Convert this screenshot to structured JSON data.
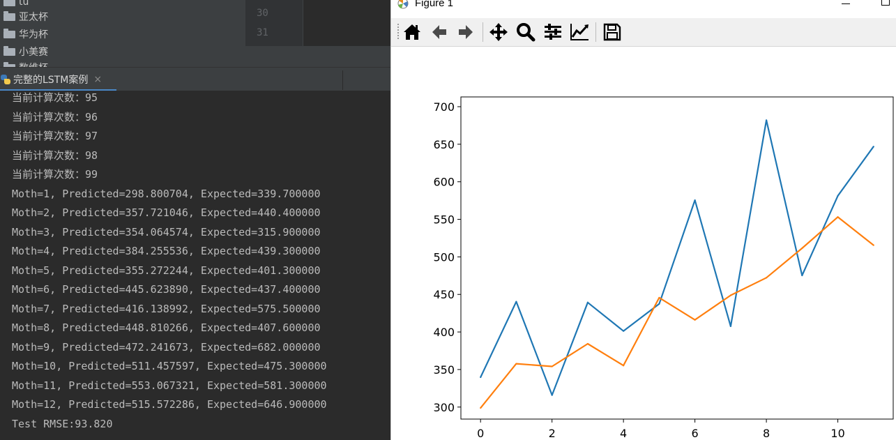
{
  "project": {
    "folders": [
      "tu",
      "亚太杯",
      "华为杯",
      "小美赛",
      "数维杯"
    ]
  },
  "gutter": {
    "lines": [
      "30",
      "31"
    ]
  },
  "run": {
    "tab_label": "完整的LSTM案例",
    "close": "×"
  },
  "console": {
    "lines": [
      "当前计算次数：95",
      "当前计算次数：96",
      "当前计算次数：97",
      "当前计算次数：98",
      "当前计算次数：99",
      "Moth=1, Predicted=298.800704, Expected=339.700000",
      "Moth=2, Predicted=357.721046, Expected=440.400000",
      "Moth=3, Predicted=354.064574, Expected=315.900000",
      "Moth=4, Predicted=384.255536, Expected=439.300000",
      "Moth=5, Predicted=355.272244, Expected=401.300000",
      "Moth=6, Predicted=445.623890, Expected=437.400000",
      "Moth=7, Predicted=416.138992, Expected=575.500000",
      "Moth=8, Predicted=448.810266, Expected=407.600000",
      "Moth=9, Predicted=472.241673, Expected=682.000000",
      "Moth=10, Predicted=511.457597, Expected=475.300000",
      "Moth=11, Predicted=553.067321, Expected=581.300000",
      "Moth=12, Predicted=515.572286, Expected=646.900000",
      "Test RMSE:93.820"
    ]
  },
  "figure": {
    "title": "Figure 1",
    "toolbar_icons": [
      "home-icon",
      "back-arrow-icon",
      "forward-arrow-icon",
      "pan-move-icon",
      "zoom-magnifier-icon",
      "configure-subplots-icon",
      "edit-axis-icon",
      "save-floppy-icon"
    ]
  },
  "chart_data": {
    "type": "line",
    "x": [
      0,
      1,
      2,
      3,
      4,
      5,
      6,
      7,
      8,
      9,
      10,
      11
    ],
    "series": [
      {
        "color": "#1f77b4",
        "values": [
          339.7,
          440.4,
          315.9,
          439.3,
          401.3,
          437.4,
          575.5,
          407.6,
          682.0,
          475.3,
          581.3,
          646.9
        ]
      },
      {
        "color": "#ff7f0e",
        "values": [
          298.800704,
          357.721046,
          354.064574,
          384.255536,
          355.272244,
          445.62389,
          416.138992,
          448.810266,
          472.241673,
          511.457597,
          553.067321,
          515.572286
        ]
      }
    ],
    "xticks": [
      0,
      2,
      4,
      6,
      8,
      10
    ],
    "yticks": [
      300,
      350,
      400,
      450,
      500,
      550,
      600,
      650,
      700
    ],
    "xlim": [
      -0.55,
      11.55
    ],
    "ylim": [
      284,
      713
    ],
    "grid": false,
    "title": "",
    "xlabel": "",
    "ylabel": ""
  }
}
